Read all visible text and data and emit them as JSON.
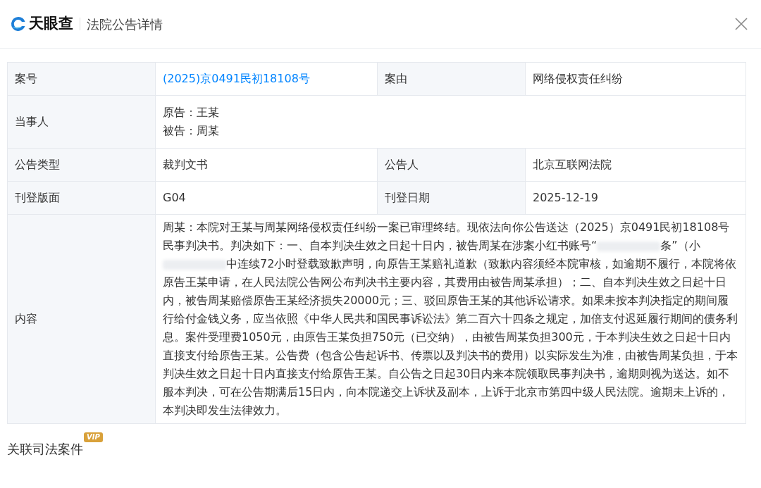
{
  "header": {
    "brand": "天眼查",
    "title": "法院公告详情"
  },
  "rows": [
    {
      "kind": "pair",
      "label": "案号",
      "value": "(2025)京0491民初18108号",
      "value_is_link": true,
      "label2": "案由",
      "value2": "网络侵权责任纠纷"
    },
    {
      "kind": "lines",
      "label": "当事人",
      "lines": [
        "原告：王某",
        "被告：周某"
      ]
    },
    {
      "kind": "pair",
      "label": "公告类型",
      "value": "裁判文书",
      "value_is_link": false,
      "label2": "公告人",
      "value2": "北京互联网法院"
    },
    {
      "kind": "pair",
      "label": "刊登版面",
      "value": "G04",
      "value_is_link": false,
      "label2": "刊登日期",
      "value2": "2025-12-19"
    },
    {
      "kind": "paragraph",
      "label": "内容",
      "segments": [
        {
          "kind": "text",
          "text": "周某：本院对王某与周某网络侵权责任纠纷一案已审理终结。现依法向你公告送达（2025）京0491民初18108号民事判决书。判决如下：一、自本判决生效之日起十日内，被告周某在涉案小红书账号“"
        },
        {
          "kind": "redacted"
        },
        {
          "kind": "text",
          "text": "条”（小"
        },
        {
          "kind": "redacted"
        },
        {
          "kind": "text",
          "text": "中连续72小时登载致歉声明，向原告王某赔礼道歉（致歉内容须经本院审核，如逾期不履行，本院将依原告王某申请，在人民法院公告网公布判决书主要内容，其费用由被告周某承担）；二、自本判决生效之日起十日内，被告周某赔偿原告王某经济损失20000元；三、驳回原告王某的其他诉讼请求。如果未按本判决指定的期间履行给付金钱义务，应当依照《中华人民共和国民事诉讼法》第二百六十四条之规定，加倍支付迟延履行期间的债务利息。案件受理费1050元，由原告王某负担750元（已交纳），由被告周某负担300元，于本判决生效之日起十日内直接支付给原告王某。公告费（包含公告起诉书、传票以及判决书的费用）以实际发生为准，由被告周某负担，于本判决生效之日起十日内直接支付给原告王某。自公告之日起30日内来本院领取民事判决书，逾期则视为送达。如不服本判决，可在公告期满后15日内，向本院递交上诉状及副本，上诉于北京市第四中级人民法院。逾期未上诉的，本判决即发生法律效力。"
        }
      ]
    }
  ],
  "related": {
    "title": "关联司法案件",
    "badge": "VIP"
  }
}
